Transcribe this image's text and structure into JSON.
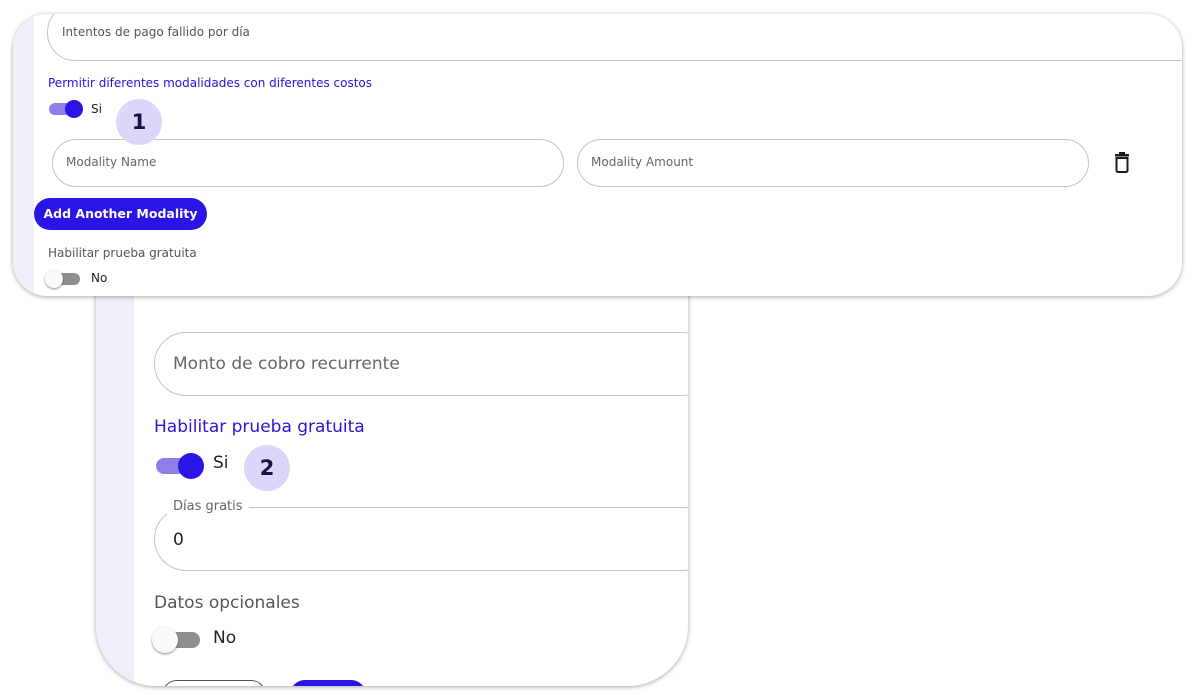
{
  "back": {
    "recurring_amount_placeholder": "Monto de cobro recurrente",
    "free_trial_title": "Habilitar prueba gratuita",
    "free_trial_toggle_label": "Si",
    "free_trial_toggle_on": true,
    "free_days_label": "Días gratis",
    "free_days_value": "0",
    "optional_data_title": "Datos opcionales",
    "optional_data_toggle_label": "No",
    "optional_data_toggle_on": false
  },
  "front": {
    "failed_attempts_placeholder": "Intentos de pago fallido por día",
    "modalities_title": "Permitir diferentes modalidades con diferentes costos",
    "modalities_toggle_label": "Si",
    "modalities_toggle_on": true,
    "modality_name_placeholder": "Modality Name",
    "modality_amount_placeholder": "Modality Amount",
    "add_modality_label": "Add Another Modality",
    "free_trial_title": "Habilitar prueba gratuita",
    "free_trial_toggle_label": "No",
    "free_trial_toggle_on": false
  },
  "badges": {
    "step_1": "1",
    "step_2": "2"
  },
  "icons": {
    "delete": "trash-icon"
  },
  "colors": {
    "accent": "#2b14e6",
    "accent_light": "#8b7fe8",
    "badge_bg": "#dcd6fb",
    "side_strip": "#efeef9"
  }
}
